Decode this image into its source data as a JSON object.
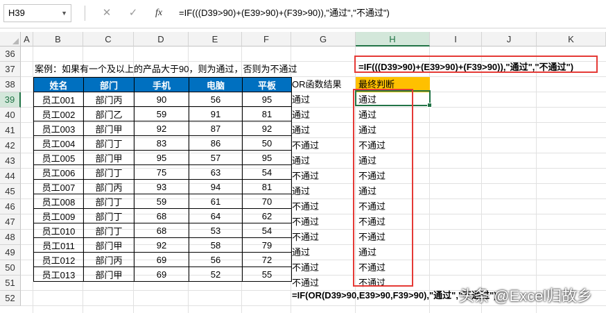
{
  "formula_bar": {
    "name_box": "H39",
    "cancel_icon": "✕",
    "enter_icon": "✓",
    "fx_icon": "fx",
    "formula": "=IF(((D39>90)+(E39>90)+(F39>90)),\"通过\",\"不通过\")"
  },
  "columns": [
    "A",
    "B",
    "C",
    "D",
    "E",
    "F",
    "G",
    "H",
    "I",
    "J",
    "K"
  ],
  "rows": [
    "36",
    "37",
    "38",
    "39",
    "40",
    "41",
    "42",
    "43",
    "44",
    "45",
    "46",
    "47",
    "48",
    "49",
    "50",
    "51",
    "52"
  ],
  "case_text": "案例：如果有一个及以上的产品大于90，则为通过，否则为不通过",
  "formula_note_top": "=IF(((D39>90)+(E39>90)+(F39>90)),\"通过\",\"不通过\")",
  "formula_note_bottom": "=IF(OR(D39>90,E39>90,F39>90),\"通过\",\"不通过\")",
  "table": {
    "headers": [
      "姓名",
      "部门",
      "手机",
      "电脑",
      "平板"
    ],
    "rows": [
      [
        "员工001",
        "部门丙",
        "90",
        "56",
        "95"
      ],
      [
        "员工002",
        "部门乙",
        "59",
        "91",
        "81"
      ],
      [
        "员工003",
        "部门甲",
        "92",
        "87",
        "92"
      ],
      [
        "员工004",
        "部门丁",
        "83",
        "86",
        "50"
      ],
      [
        "员工005",
        "部门甲",
        "95",
        "57",
        "95"
      ],
      [
        "员工006",
        "部门丁",
        "75",
        "63",
        "54"
      ],
      [
        "员工007",
        "部门丙",
        "93",
        "94",
        "81"
      ],
      [
        "员工008",
        "部门丁",
        "59",
        "61",
        "70"
      ],
      [
        "员工009",
        "部门丁",
        "68",
        "64",
        "62"
      ],
      [
        "员工010",
        "部门丁",
        "68",
        "53",
        "54"
      ],
      [
        "员工011",
        "部门甲",
        "92",
        "58",
        "79"
      ],
      [
        "员工012",
        "部门丙",
        "69",
        "56",
        "72"
      ],
      [
        "员工013",
        "部门甲",
        "69",
        "52",
        "55"
      ]
    ]
  },
  "or_result_header": "OR函数结果",
  "or_results": [
    "通过",
    "通过",
    "通过",
    "不通过",
    "通过",
    "不通过",
    "通过",
    "不通过",
    "不通过",
    "不通过",
    "通过",
    "不通过",
    "不通过"
  ],
  "final_header": "最终判断",
  "final_results": [
    "通过",
    "通过",
    "通过",
    "不通过",
    "通过",
    "不通过",
    "通过",
    "不通过",
    "不通过",
    "不通过",
    "通过",
    "不通过",
    "不通过"
  ],
  "watermark": "头条 @Excel归故乡",
  "colors": {
    "table_header": "#0070c0",
    "final_header": "#ffc000",
    "highlight_box": "#e53935",
    "selection": "#217346"
  }
}
